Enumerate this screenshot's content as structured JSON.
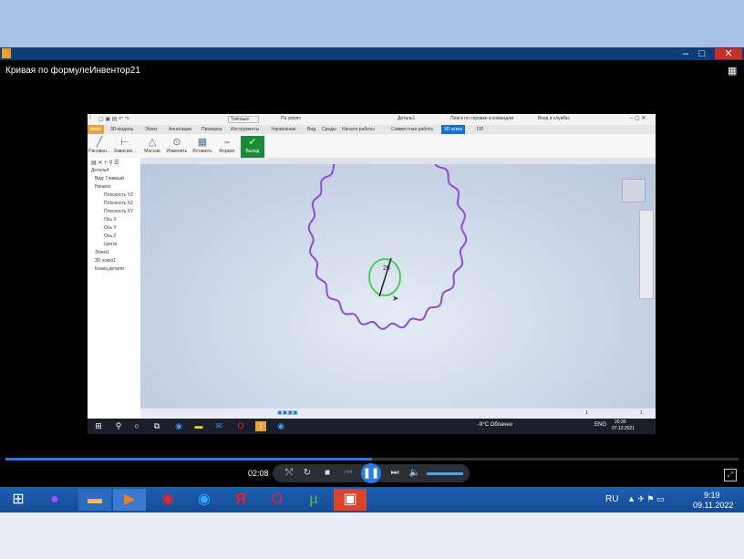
{
  "player": {
    "title": "Кривая по формулеИнвентор21",
    "time": "02:08",
    "progress_fraction": 0.5
  },
  "inventor": {
    "doc_title": "Деталь1",
    "appearance": "Типовые",
    "material": "По умолч",
    "search": "Поиск по справке и командам",
    "signin": "Вход в службы",
    "tabs": [
      "Файл",
      "3D-модель",
      "Эскиз",
      "Аннотации",
      "Проверка",
      "Инструменты",
      "Управление",
      "Вид",
      "Среды",
      "Начало работы",
      "Совместная работа",
      "3D эскиз",
      "DD"
    ],
    "tools": [
      "Рисован...",
      "Зависим...",
      "Массив",
      "Изменить",
      "Вставить",
      "Формат",
      "Выход"
    ],
    "tree": [
      "Деталь4",
      "Вид: Главный",
      "Начало",
      "Плоскость YZ",
      "Плоскость XZ",
      "Плоскость XY",
      "Ось X",
      "Ось Y",
      "Ось Z",
      "Центр",
      "Эскиз1",
      "3D эскиз1",
      "Конец детали"
    ],
    "dimension": "20",
    "status_nums": [
      "1",
      "1"
    ]
  },
  "inner_taskbar": {
    "weather": "-9°C Облачно",
    "lang": "ENG",
    "time": "20:30",
    "date": "07.12.2021"
  },
  "taskbar": {
    "lang": "RU",
    "time": "9:19",
    "date": "09.11.2022"
  },
  "colors": {
    "curve": "#8a4fd6",
    "circle": "#38d04a",
    "accent": "#1a70c8"
  }
}
